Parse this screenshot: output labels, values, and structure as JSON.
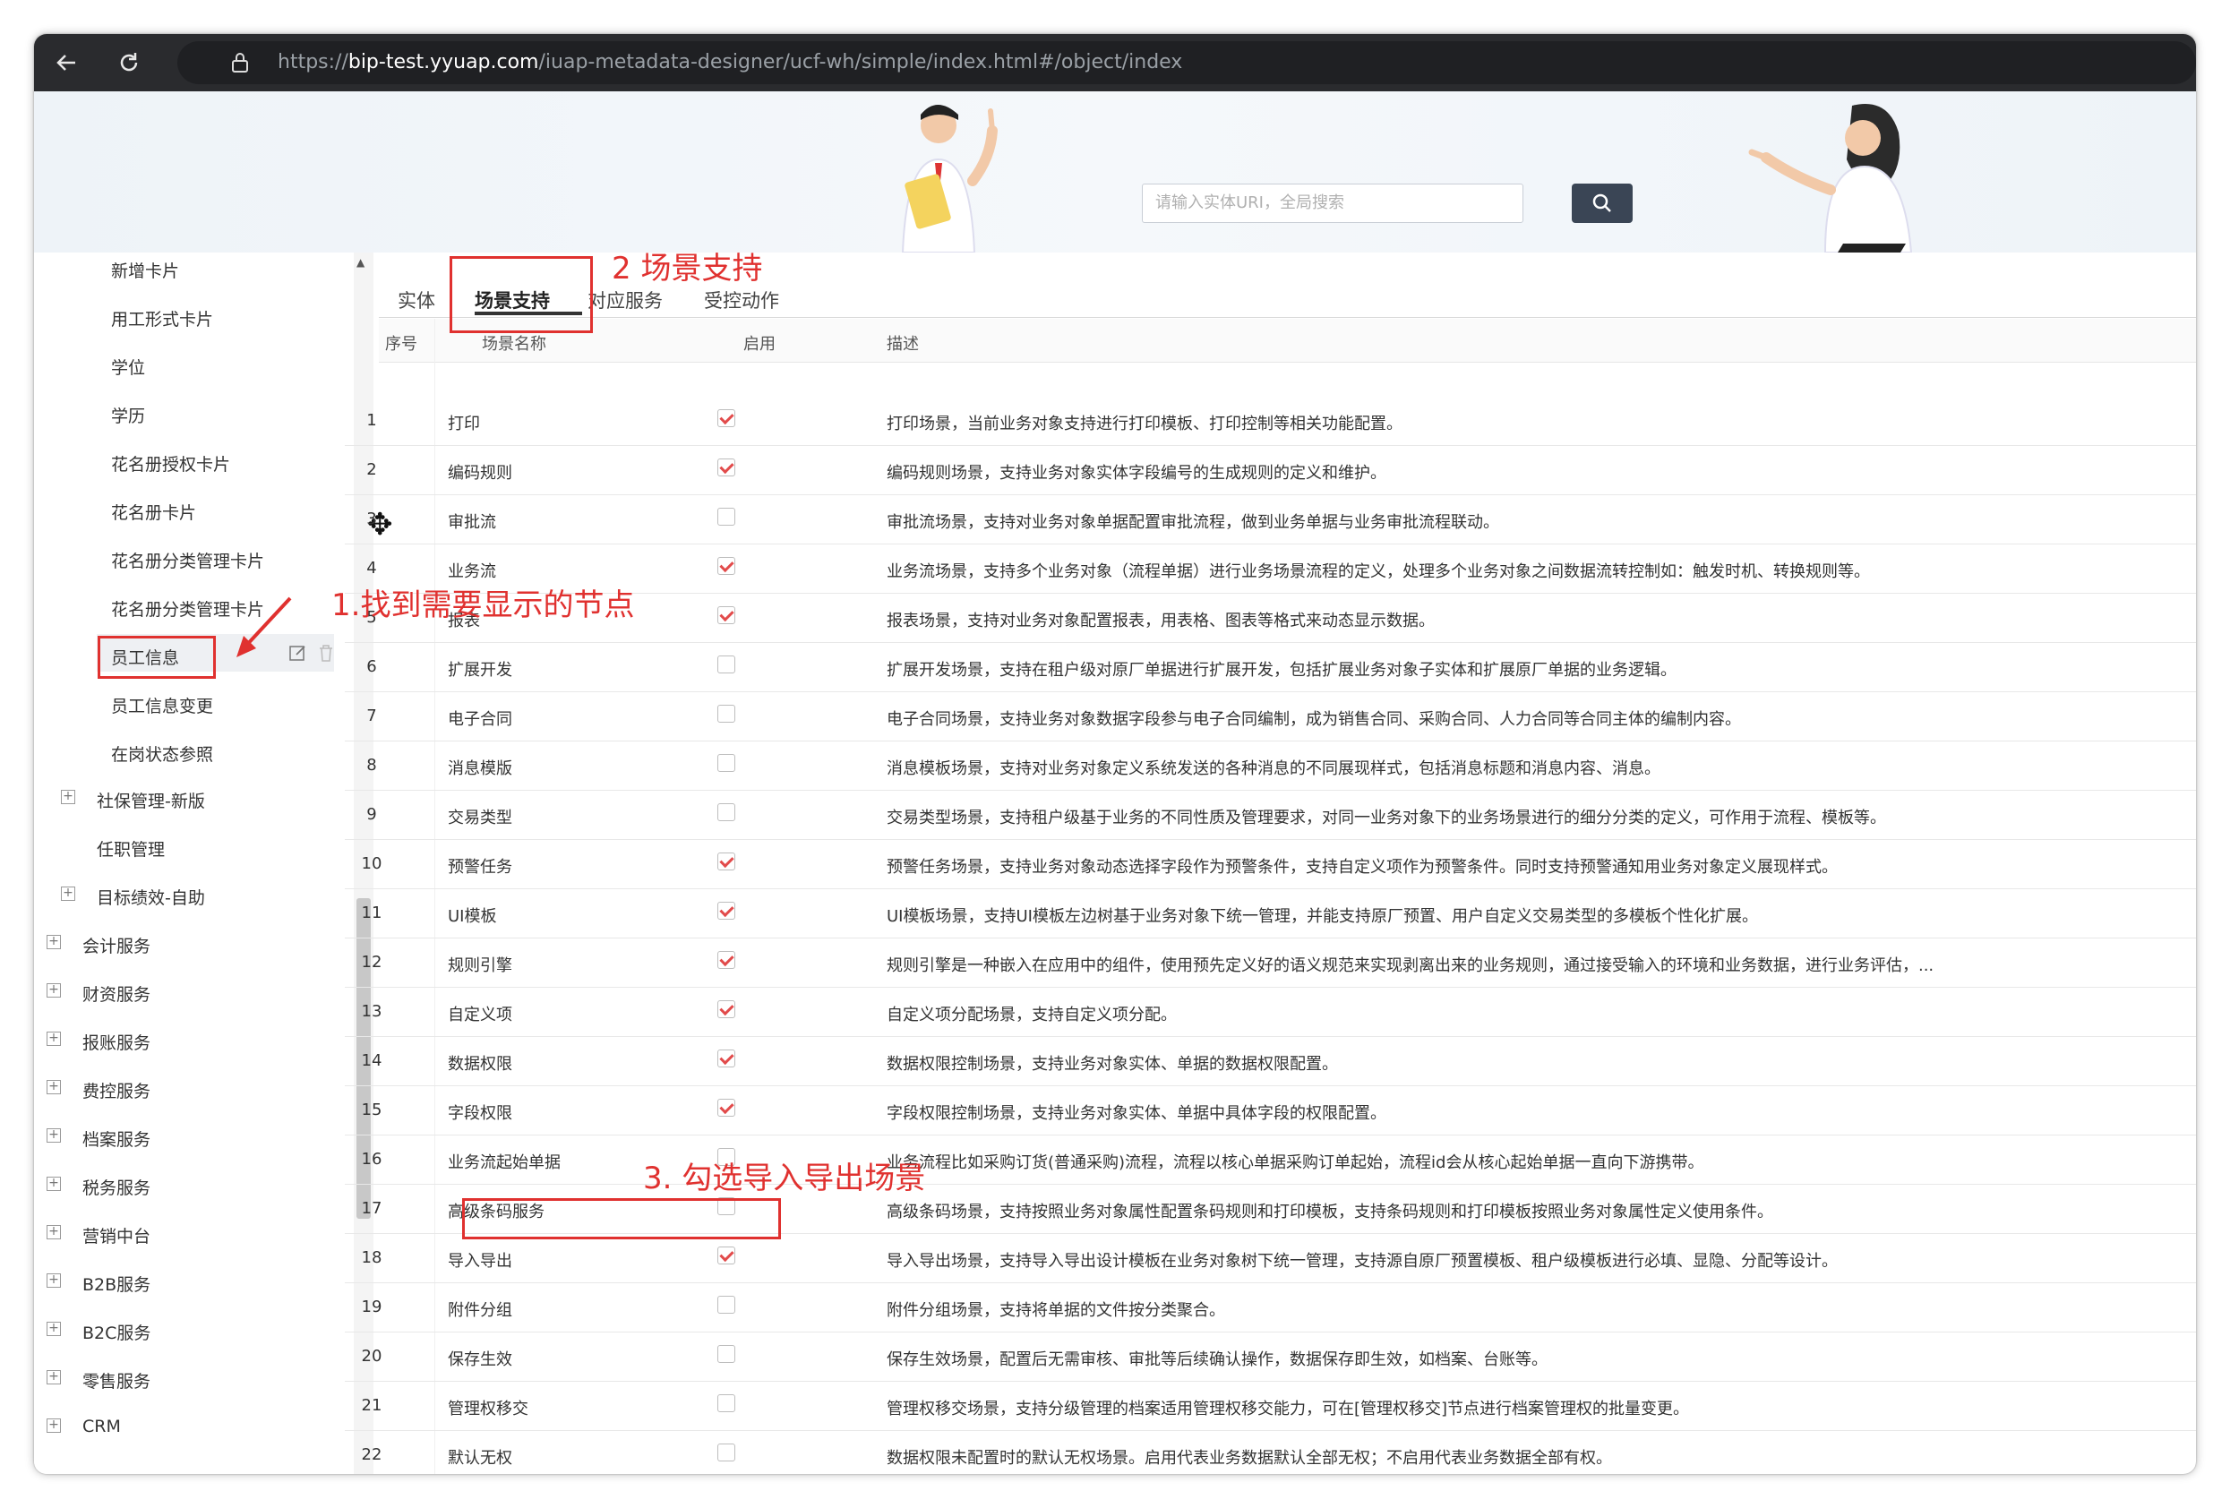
{
  "browser": {
    "url_scheme": "https://",
    "url_host": "bip-test.yyuap.com",
    "url_path": "/iuap-metadata-designer/ucf-wh/simple/index.html#/object/index"
  },
  "search": {
    "placeholder": "请输入实体URI，全局搜索"
  },
  "sidebar": {
    "items": [
      "新增卡片",
      "用工形式卡片",
      "学位",
      "学历",
      "花名册授权卡片",
      "花名册卡片",
      "花名册分类管理卡片",
      "花名册分类管理卡片",
      "员工信息",
      "员工信息变更",
      "在岗状态参照"
    ],
    "groups_level2": [
      "社保管理-新版",
      "任职管理",
      "目标绩效-自助"
    ],
    "groups_level1": [
      "会计服务",
      "财资服务",
      "报账服务",
      "费控服务",
      "档案服务",
      "税务服务",
      "营销中台",
      "B2B服务",
      "B2C服务",
      "零售服务",
      "CRM"
    ]
  },
  "tabs": [
    "实体",
    "场景支持",
    "对应服务",
    "受控动作"
  ],
  "table": {
    "headers": [
      "序号",
      "场景名称",
      "启用",
      "描述"
    ],
    "rows": [
      {
        "no": "1",
        "name": "打印",
        "on": true,
        "desc": "打印场景，当前业务对象支持进行打印模板、打印控制等相关功能配置。"
      },
      {
        "no": "2",
        "name": "编码规则",
        "on": true,
        "desc": "编码规则场景，支持业务对象实体字段编号的生成规则的定义和维护。"
      },
      {
        "no": "3",
        "name": "审批流",
        "on": false,
        "desc": "审批流场景，支持对业务对象单据配置审批流程，做到业务单据与业务审批流程联动。"
      },
      {
        "no": "4",
        "name": "业务流",
        "on": true,
        "desc": "业务流场景，支持多个业务对象（流程单据）进行业务场景流程的定义，处理多个业务对象之间数据流转控制如：触发时机、转换规则等。"
      },
      {
        "no": "5",
        "name": "报表",
        "on": true,
        "desc": "报表场景，支持对业务对象配置报表，用表格、图表等格式来动态显示数据。"
      },
      {
        "no": "6",
        "name": "扩展开发",
        "on": false,
        "desc": "扩展开发场景，支持在租户级对原厂单据进行扩展开发，包括扩展业务对象子实体和扩展原厂单据的业务逻辑。"
      },
      {
        "no": "7",
        "name": "电子合同",
        "on": false,
        "desc": "电子合同场景，支持业务对象数据字段参与电子合同编制，成为销售合同、采购合同、人力合同等合同主体的编制内容。"
      },
      {
        "no": "8",
        "name": "消息模版",
        "on": false,
        "desc": "消息模板场景，支持对业务对象定义系统发送的各种消息的不同展现样式，包括消息标题和消息内容、消息。"
      },
      {
        "no": "9",
        "name": "交易类型",
        "on": false,
        "desc": "交易类型场景，支持租户级基于业务的不同性质及管理要求，对同一业务对象下的业务场景进行的细分分类的定义，可作用于流程、模板等。"
      },
      {
        "no": "10",
        "name": "预警任务",
        "on": true,
        "desc": "预警任务场景，支持业务对象动态选择字段作为预警条件，支持自定义项作为预警条件。同时支持预警通知用业务对象定义展现样式。"
      },
      {
        "no": "11",
        "name": "UI模板",
        "on": true,
        "desc": "UI模板场景，支持UI模板左边树基于业务对象下统一管理，并能支持原厂预置、用户自定义交易类型的多模板个性化扩展。"
      },
      {
        "no": "12",
        "name": "规则引擎",
        "on": true,
        "desc": "规则引擎是一种嵌入在应用中的组件，使用预先定义好的语义规范来实现剥离出来的业务规则，通过接受输入的环境和业务数据，进行业务评估，..."
      },
      {
        "no": "13",
        "name": "自定义项",
        "on": true,
        "desc": "自定义项分配场景，支持自定义项分配。"
      },
      {
        "no": "14",
        "name": "数据权限",
        "on": true,
        "desc": "数据权限控制场景，支持业务对象实体、单据的数据权限配置。"
      },
      {
        "no": "15",
        "name": "字段权限",
        "on": true,
        "desc": "字段权限控制场景，支持业务对象实体、单据中具体字段的权限配置。"
      },
      {
        "no": "16",
        "name": "业务流起始单据",
        "on": false,
        "desc": "业务流程比如采购订货(普通采购)流程，流程以核心单据采购订单起始，流程id会从核心起始单据一直向下游携带。"
      },
      {
        "no": "17",
        "name": "高级条码服务",
        "on": false,
        "desc": "高级条码场景，支持按照业务对象属性配置条码规则和打印模板，支持条码规则和打印模板按照业务对象属性定义使用条件。"
      },
      {
        "no": "18",
        "name": "导入导出",
        "on": true,
        "desc": "导入导出场景，支持导入导出设计模板在业务对象树下统一管理，支持源自原厂预置模板、租户级模板进行必填、显隐、分配等设计。"
      },
      {
        "no": "19",
        "name": "附件分组",
        "on": false,
        "desc": "附件分组场景，支持将单据的文件按分类聚合。"
      },
      {
        "no": "20",
        "name": "保存生效",
        "on": false,
        "desc": "保存生效场景，配置后无需审核、审批等后续确认操作，数据保存即生效，如档案、台账等。"
      },
      {
        "no": "21",
        "name": "管理权移交",
        "on": false,
        "desc": "管理权移交场景，支持分级管理的档案适用管理权移交能力，可在[管理权移交]节点进行档案管理权的批量变更。"
      },
      {
        "no": "22",
        "name": "默认无权",
        "on": false,
        "desc": "数据权限未配置时的默认无权场景。启用代表业务数据默认全部无权；不启用代表业务数据全部有权。"
      }
    ]
  },
  "annotations": {
    "step1": "1.找到需要显示的节点",
    "step2": "2 场景支持",
    "step3": "3. 勾选导入导出场景"
  }
}
